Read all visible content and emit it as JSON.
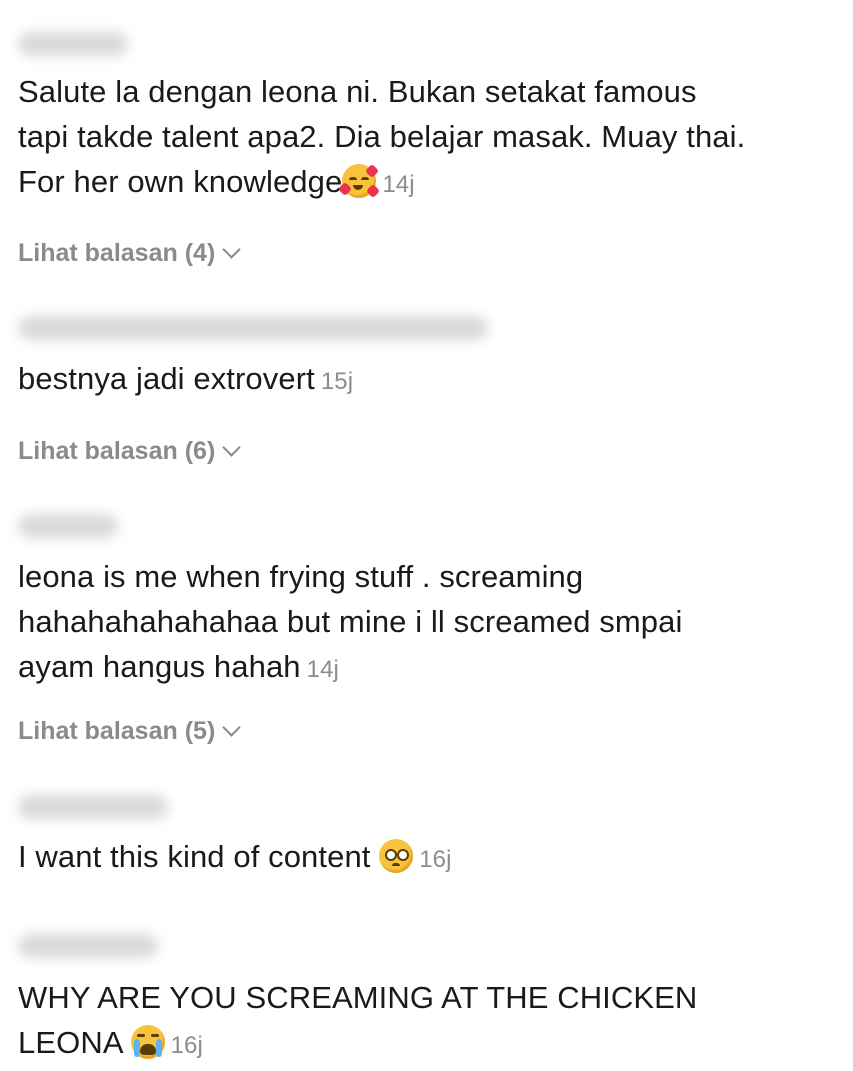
{
  "comments": [
    {
      "lines": [
        "Salute la dengan leona ni. Bukan setakat famous",
        "tapi takde talent apa2. Dia belajar masak. Muay thai.",
        "For her own knowledge"
      ],
      "emoji": "smiling-face-with-hearts-emoji",
      "time": "14j",
      "replies": "Lihat balasan (4)"
    },
    {
      "lines": [
        "bestnya jadi extrovert"
      ],
      "time": "15j",
      "replies": "Lihat balasan (6)"
    },
    {
      "lines": [
        "leona is me when frying stuff . screaming",
        "hahahahahahahaa but mine i ll screamed smpai",
        "ayam hangus hahah"
      ],
      "time": "14j",
      "replies": "Lihat balasan (5)"
    },
    {
      "lines": [
        "I want this kind of content "
      ],
      "emoji": "pleading-face-emoji",
      "time": "16j"
    },
    {
      "lines": [
        "WHY ARE YOU SCREAMING AT THE CHICKEN",
        "LEONA "
      ],
      "emoji": "loudly-crying-face-emoji",
      "time": "16j"
    }
  ]
}
